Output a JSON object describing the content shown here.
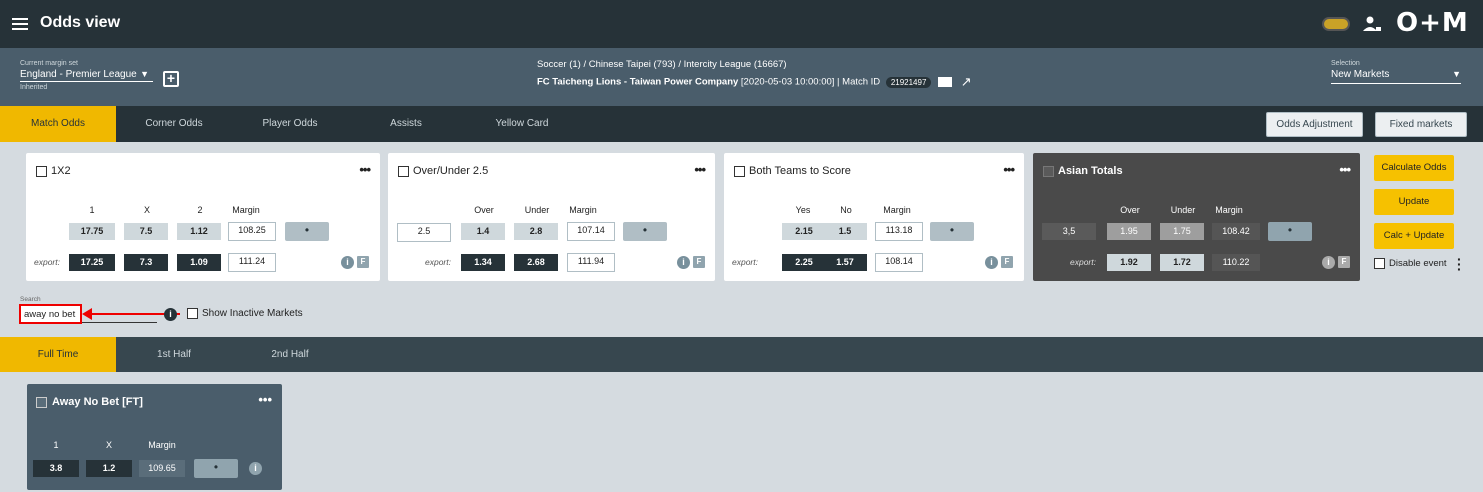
{
  "header": {
    "title": "Odds view",
    "logo": "O+M"
  },
  "info": {
    "margin_set_label": "Current margin set",
    "margin_set_value": "England - Premier League",
    "margin_set_note": "Inherited",
    "breadcrumb": "Soccer (1) / Chinese Taipei (793) / Intercity League (16667)",
    "match_teams": "FC Taicheng Lions - Taiwan Power Company",
    "match_time": "[2020-05-03 10:00:00] | Match ID",
    "match_id": "21921497",
    "selection_label": "Selection",
    "selection_value": "New Markets"
  },
  "tabs": [
    "Match Odds",
    "Corner Odds",
    "Player Odds",
    "Assists",
    "Yellow Card"
  ],
  "top_buttons": {
    "odds_adjustment": "Odds Adjustment",
    "fixed_markets": "Fixed markets"
  },
  "markets": [
    {
      "title": "1X2",
      "headers": [
        "1",
        "X",
        "2",
        "Margin"
      ],
      "odds": [
        "17.75",
        "7.5",
        "1.12",
        "108.25"
      ],
      "export_label": "export:",
      "export": [
        "17.25",
        "7.3",
        "1.09",
        "111.24"
      ]
    },
    {
      "title": "Over/Under 2.5",
      "line": "2.5",
      "headers": [
        "Over",
        "Under",
        "Margin"
      ],
      "odds": [
        "1.4",
        "2.8",
        "107.14"
      ],
      "export_label": "export:",
      "export": [
        "1.34",
        "2.68",
        "111.94"
      ]
    },
    {
      "title": "Both Teams to Score",
      "headers": [
        "Yes",
        "No",
        "Margin"
      ],
      "odds": [
        "2.15",
        "1.5",
        "113.18"
      ],
      "export_label": "export:",
      "export": [
        "2.25",
        "1.57",
        "108.14"
      ]
    },
    {
      "title": "Asian Totals",
      "line": "3,5",
      "headers": [
        "Over",
        "Under",
        "Margin"
      ],
      "odds": [
        "1.95",
        "1.75",
        "108.42"
      ],
      "export_label": "export:",
      "export": [
        "1.92",
        "1.72",
        "110.22"
      ]
    }
  ],
  "actions": {
    "calculate": "Calculate Odds",
    "update": "Update",
    "calc_update": "Calc + Update",
    "disable_event": "Disable event"
  },
  "search": {
    "label": "Search",
    "value": "away no bet",
    "show_inactive": "Show Inactive Markets"
  },
  "periods": [
    "Full Time",
    "1st Half",
    "2nd Half"
  ],
  "result_market": {
    "title": "Away No Bet [FT]",
    "headers": [
      "1",
      "X",
      "Margin"
    ],
    "odds": [
      "3.8",
      "1.2",
      "109.65"
    ]
  },
  "icons": {
    "menu": "hamburger-icon",
    "user": "user-icon",
    "info": "info-icon",
    "f": "f-badge-icon",
    "add": "plus-box-icon",
    "message": "message-icon",
    "external": "external-link-icon"
  },
  "colors": {
    "accent": "#f0b800",
    "dark": "#263238",
    "slate": "#4a5d6b"
  }
}
